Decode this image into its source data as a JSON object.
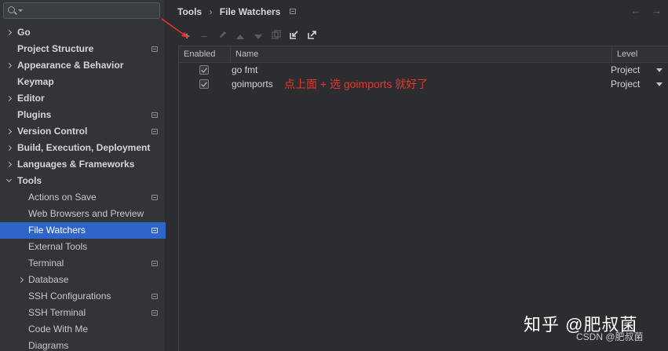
{
  "search": {
    "placeholder": ""
  },
  "sidebar": {
    "items": [
      {
        "label": "Go",
        "chevron": "right",
        "bold": true,
        "settings_icon": false
      },
      {
        "label": "Project Structure",
        "chevron": null,
        "bold": true,
        "settings_icon": true
      },
      {
        "label": "Appearance & Behavior",
        "chevron": "right",
        "bold": true,
        "settings_icon": false
      },
      {
        "label": "Keymap",
        "chevron": null,
        "bold": true,
        "settings_icon": false
      },
      {
        "label": "Editor",
        "chevron": "right",
        "bold": true,
        "settings_icon": false
      },
      {
        "label": "Plugins",
        "chevron": null,
        "bold": true,
        "settings_icon": true
      },
      {
        "label": "Version Control",
        "chevron": "right",
        "bold": true,
        "settings_icon": true
      },
      {
        "label": "Build, Execution, Deployment",
        "chevron": "right",
        "bold": true,
        "settings_icon": false
      },
      {
        "label": "Languages & Frameworks",
        "chevron": "right",
        "bold": true,
        "settings_icon": false
      },
      {
        "label": "Tools",
        "chevron": "down",
        "bold": true,
        "settings_icon": false
      },
      {
        "label": "Actions on Save",
        "chevron": null,
        "bold": false,
        "settings_icon": true
      },
      {
        "label": "Web Browsers and Preview",
        "chevron": null,
        "bold": false,
        "settings_icon": false
      },
      {
        "label": "File Watchers",
        "chevron": null,
        "bold": false,
        "settings_icon": true,
        "selected": true
      },
      {
        "label": "External Tools",
        "chevron": null,
        "bold": false,
        "settings_icon": false
      },
      {
        "label": "Terminal",
        "chevron": null,
        "bold": false,
        "settings_icon": true
      },
      {
        "label": "Database",
        "chevron": "right",
        "bold": false,
        "settings_icon": false
      },
      {
        "label": "SSH Configurations",
        "chevron": null,
        "bold": false,
        "settings_icon": true
      },
      {
        "label": "SSH Terminal",
        "chevron": null,
        "bold": false,
        "settings_icon": true
      },
      {
        "label": "Code With Me",
        "chevron": null,
        "bold": false,
        "settings_icon": false
      },
      {
        "label": "Diagrams",
        "chevron": null,
        "bold": false,
        "settings_icon": false
      }
    ]
  },
  "breadcrumb": {
    "parent": "Tools",
    "separator": "›",
    "current": "File Watchers"
  },
  "nav": {
    "back": "←",
    "forward": "→"
  },
  "toolbar": {
    "add_icon": "plus-icon",
    "remove_icon": "minus-icon",
    "edit_icon": "pencil-icon",
    "up_icon": "arrow-up-icon",
    "down_icon": "arrow-down-icon",
    "copy_icon": "copy-icon",
    "import_icon": "import-icon",
    "export_icon": "export-icon"
  },
  "table": {
    "columns": [
      "Enabled",
      "Name",
      "Level"
    ],
    "rows": [
      {
        "enabled": true,
        "name": "go fmt",
        "level": "Project"
      },
      {
        "enabled": true,
        "name": "goimports",
        "level": "Project"
      }
    ]
  },
  "annotation": {
    "text": "点上面 + 选 goimports 就好了",
    "color": "#e8352e"
  },
  "watermark": {
    "main": "知乎 @肥叔菌",
    "sub": "CSDN @肥叔菌"
  },
  "colors": {
    "selection": "#2f65ca",
    "background": "#2b2d30",
    "sidebar": "#323438"
  }
}
